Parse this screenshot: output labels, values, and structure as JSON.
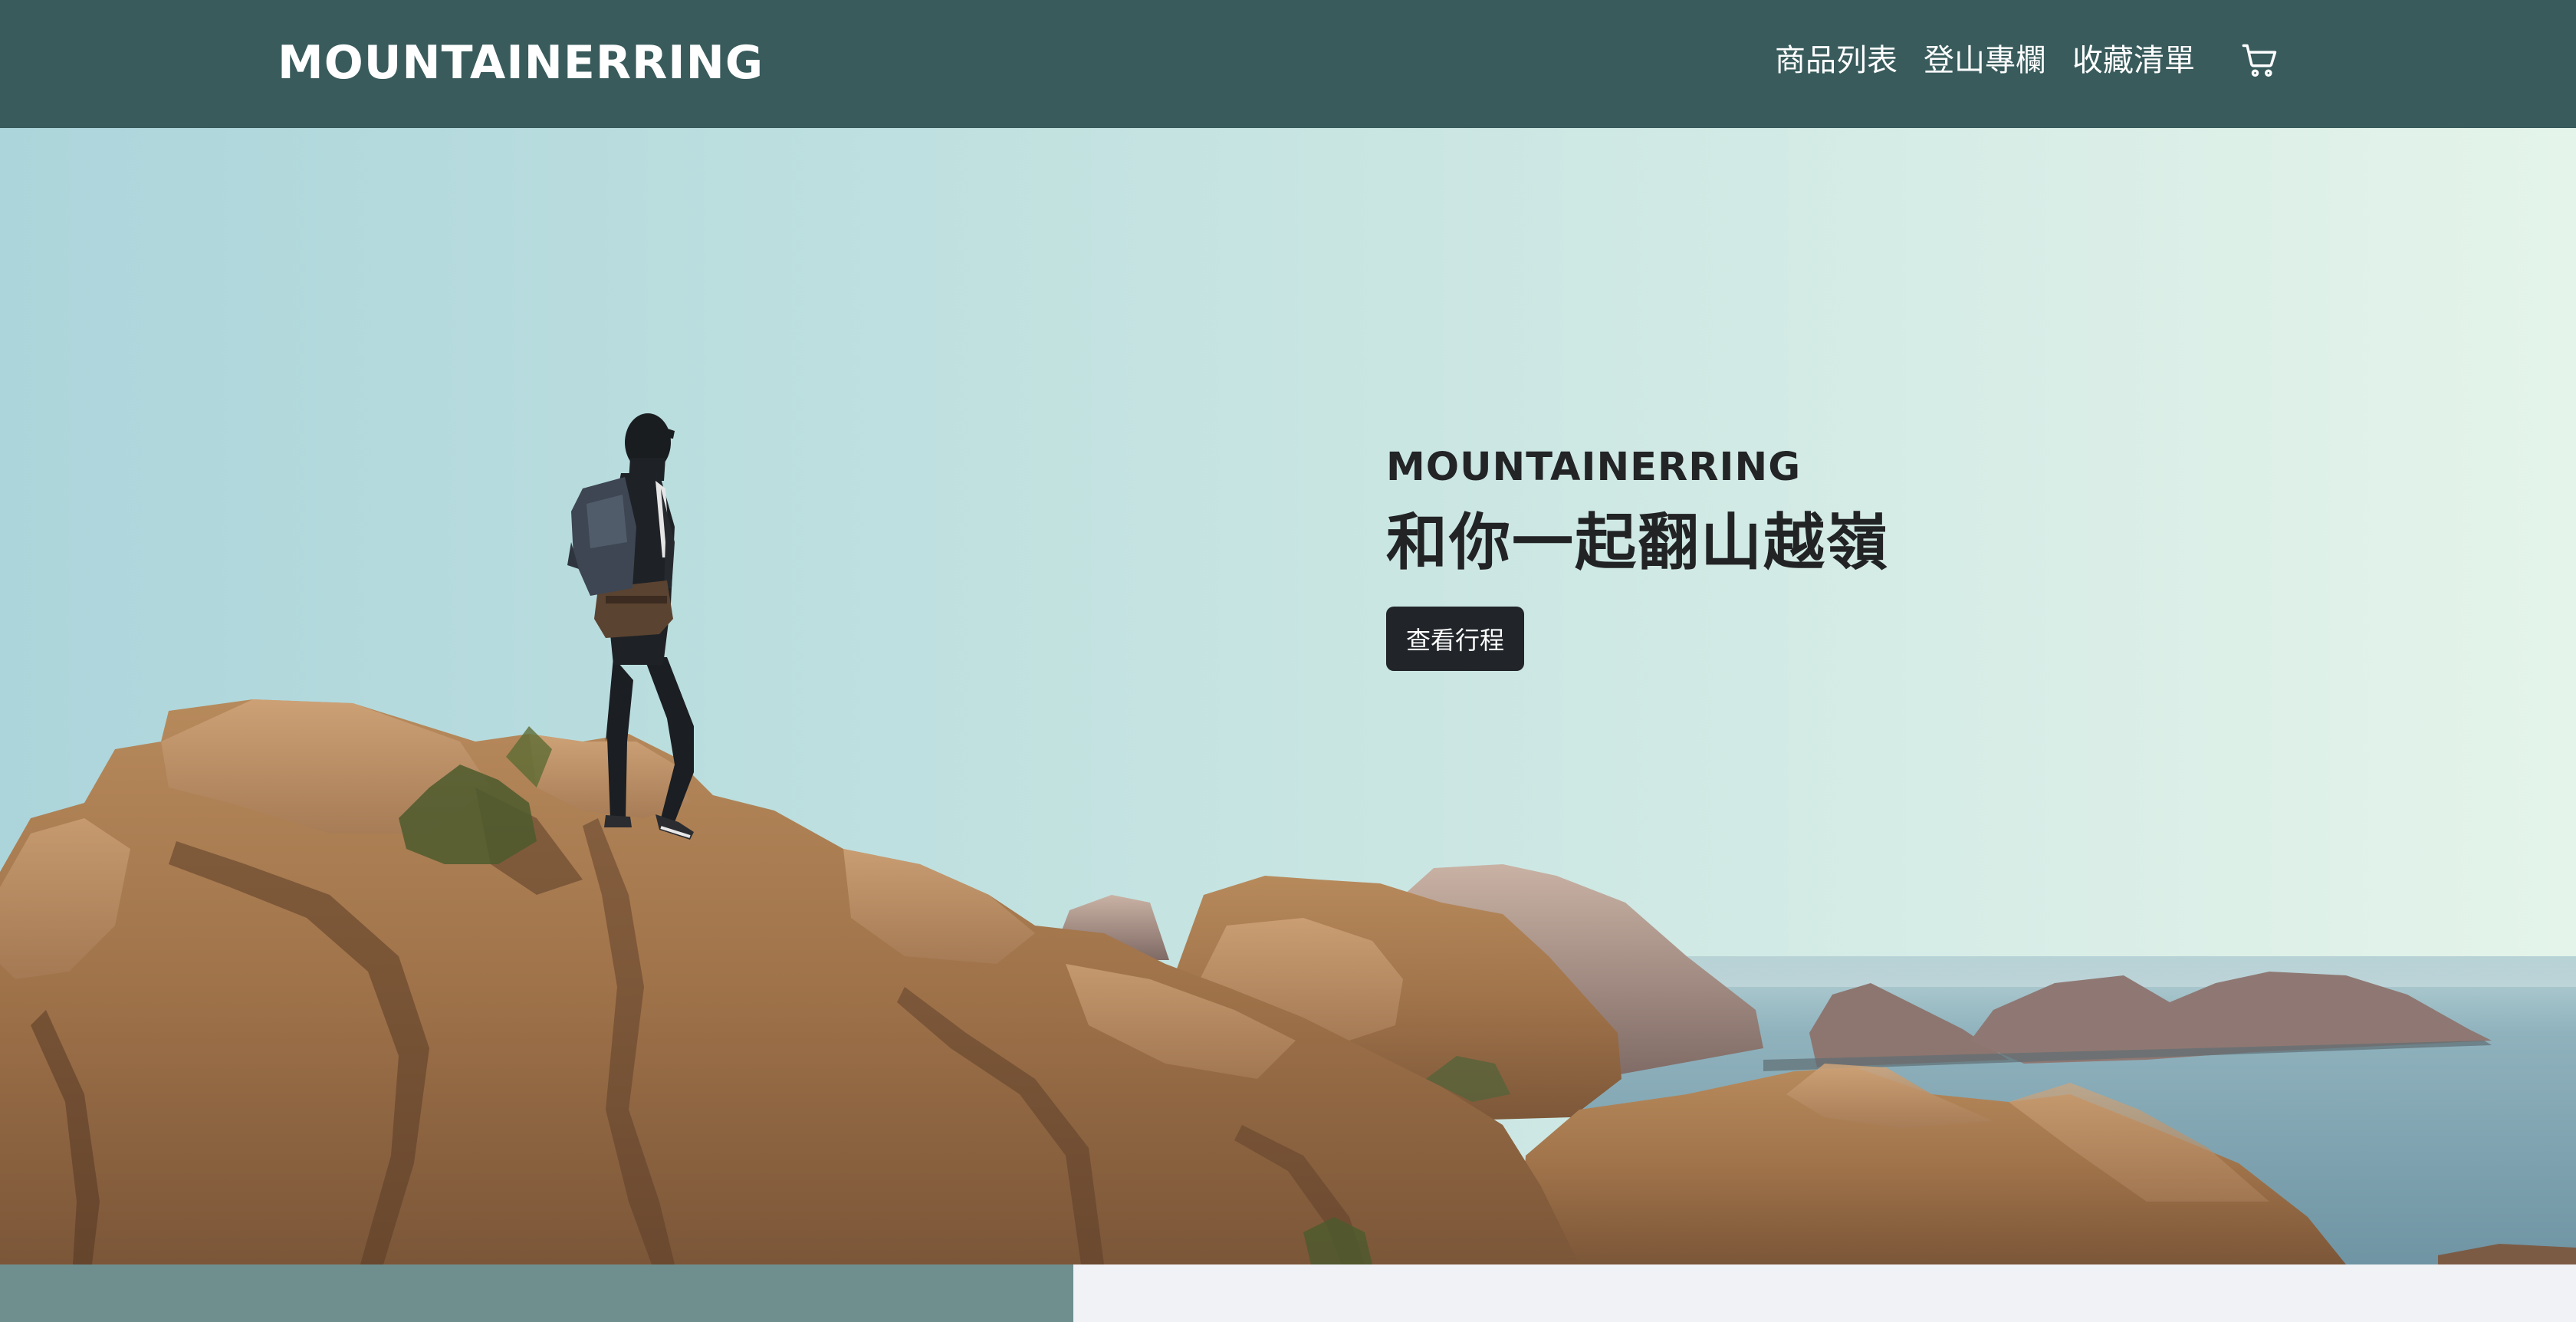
{
  "navbar": {
    "brand": "MOUNTAINERRING",
    "links": [
      {
        "label": "商品列表"
      },
      {
        "label": "登山專欄"
      },
      {
        "label": "收藏清單"
      }
    ],
    "cart_icon": "cart-icon",
    "background": "#395b5c"
  },
  "hero": {
    "kicker": "MOUNTAINERRING",
    "title": "和你一起翻山越嶺",
    "button_label": "查看行程",
    "button_color": "#212529",
    "image_icon": "hiker-on-rocks-photo"
  }
}
